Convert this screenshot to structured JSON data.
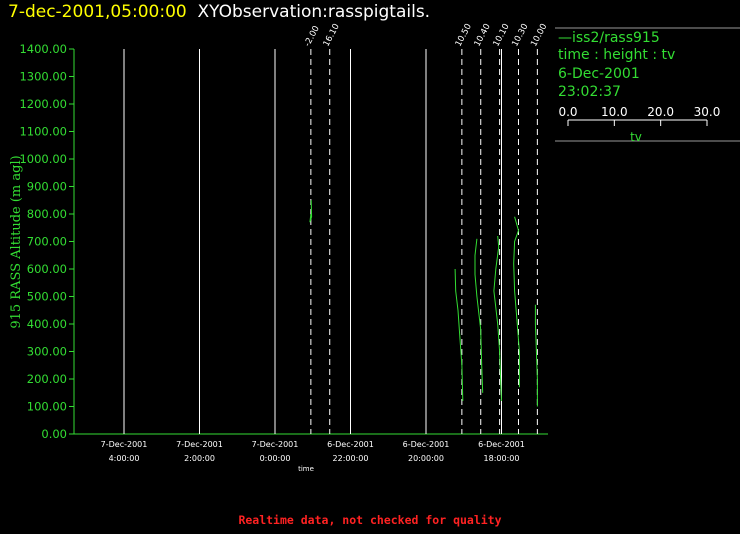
{
  "header": {
    "date": "7-dec-2001,05:00:00",
    "observation": "XYObservation:rasspigtails."
  },
  "legend": {
    "line1": "iss2/rass915",
    "line2": "time : height : tv",
    "line3": "6-Dec-2001",
    "line4": "23:02:37",
    "scale_ticks": [
      "0.0",
      "10.0",
      "20.0",
      "30.0"
    ],
    "scale_label": "tv"
  },
  "footer": "Realtime data, not checked for quality",
  "colors": {
    "axis": "#33dd33",
    "title_date": "#ffff00",
    "title_obs": "#ffffff",
    "footer": "#ff2222",
    "trace": "#33dd33"
  },
  "chart_data": {
    "type": "line",
    "xlabel": "time",
    "ylabel": "915 RASS Altitude (m agl)",
    "x_direction": "reversed",
    "xlim": [
      "7-Dec-2001 05:00:00",
      "6-Dec-2001 16:50:00"
    ],
    "ylim": [
      0,
      1400
    ],
    "y_ticks": [
      "0.00",
      "100.00",
      "200.00",
      "300.00",
      "400.00",
      "500.00",
      "600.00",
      "700.00",
      "800.00",
      "900.00",
      "1000.00",
      "1100.00",
      "1200.00",
      "1300.00",
      "1400.00"
    ],
    "x_ticks": [
      {
        "date": "7-Dec-2001",
        "time": "4:00:00",
        "t": 4
      },
      {
        "date": "7-Dec-2001",
        "time": "2:00:00",
        "t": 2
      },
      {
        "date": "7-Dec-2001",
        "time": "0:00:00",
        "t": 0
      },
      {
        "date": "6-Dec-2001",
        "time": "22:00:00",
        "t": -2
      },
      {
        "date": "6-Dec-2001",
        "time": "20:00:00",
        "t": -4
      },
      {
        "date": "6-Dec-2001",
        "time": "18:00:00",
        "t": -6
      }
    ],
    "profiles": [
      {
        "time_label": "-2.00",
        "t": -0.95,
        "points": [
          [
            0,
            800
          ],
          [
            -0.05,
            770
          ],
          [
            0.04,
            790
          ],
          [
            0.03,
            820
          ],
          [
            0.02,
            850
          ]
        ]
      },
      {
        "time_label": "16.10",
        "t": -1.45,
        "points": []
      },
      {
        "time_label": "10.50",
        "t": -4.95,
        "points": [
          [
            -0.35,
            600
          ],
          [
            -0.32,
            520
          ],
          [
            -0.2,
            450
          ],
          [
            -0.1,
            350
          ],
          [
            0,
            250
          ],
          [
            0.05,
            120
          ]
        ]
      },
      {
        "time_label": "10.40",
        "t": -5.45,
        "points": [
          [
            -0.2,
            710
          ],
          [
            -0.3,
            650
          ],
          [
            -0.3,
            580
          ],
          [
            -0.2,
            500
          ],
          [
            0,
            380
          ],
          [
            0.05,
            250
          ],
          [
            0.1,
            150
          ]
        ]
      },
      {
        "time_label": "10.10",
        "t": -5.95,
        "points": [
          [
            -0.1,
            720
          ],
          [
            -0.05,
            680
          ],
          [
            -0.2,
            600
          ],
          [
            -0.3,
            520
          ],
          [
            -0.1,
            400
          ],
          [
            0,
            300
          ],
          [
            0.05,
            200
          ],
          [
            0.1,
            120
          ]
        ]
      },
      {
        "time_label": "10.30",
        "t": -6.45,
        "points": [
          [
            -0.2,
            790
          ],
          [
            0,
            740
          ],
          [
            -0.2,
            700
          ],
          [
            -0.25,
            620
          ],
          [
            -0.2,
            520
          ],
          [
            -0.1,
            430
          ],
          [
            0.05,
            300
          ],
          [
            0.05,
            170
          ]
        ]
      },
      {
        "time_label": "10.00",
        "t": -6.95,
        "points": [
          [
            -0.1,
            470
          ],
          [
            -0.1,
            400
          ],
          [
            -0.05,
            300
          ],
          [
            0,
            200
          ],
          [
            0,
            100
          ]
        ]
      }
    ],
    "scale_min": 0,
    "scale_max": 30
  }
}
